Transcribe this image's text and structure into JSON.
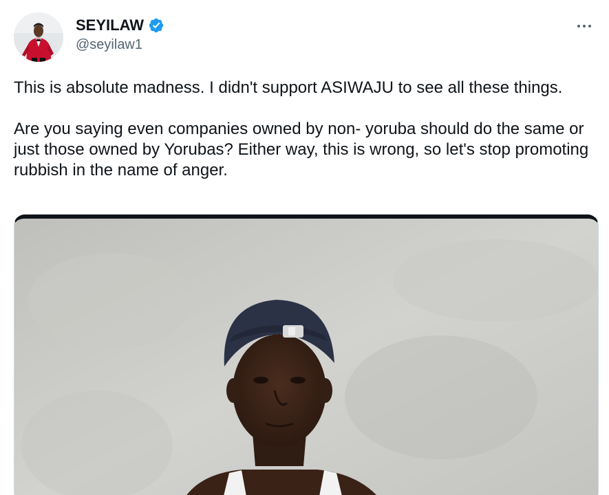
{
  "author": {
    "display_name": "SEYILAW",
    "handle": "@seyilaw1",
    "verified": true,
    "verified_color": "#1d9bf0",
    "avatar_icon": "profile-photo-red-suit"
  },
  "menu": {
    "more_icon": "more-horizontal-icon"
  },
  "tweet": {
    "paragraph_1": "This is absolute madness. I didn't support ASIWAJU to see all these things.",
    "paragraph_2": "Are you saying even companies owned by non- yoruba should do the same or just those owned by Yorubas? Either way, this is wrong, so let's stop promoting rubbish in the name of anger."
  },
  "media": {
    "type": "photo",
    "icon": "photo-man-in-cap"
  },
  "colors": {
    "text": "#0f1419",
    "secondary_text": "#536471",
    "verified": "#1d9bf0"
  }
}
